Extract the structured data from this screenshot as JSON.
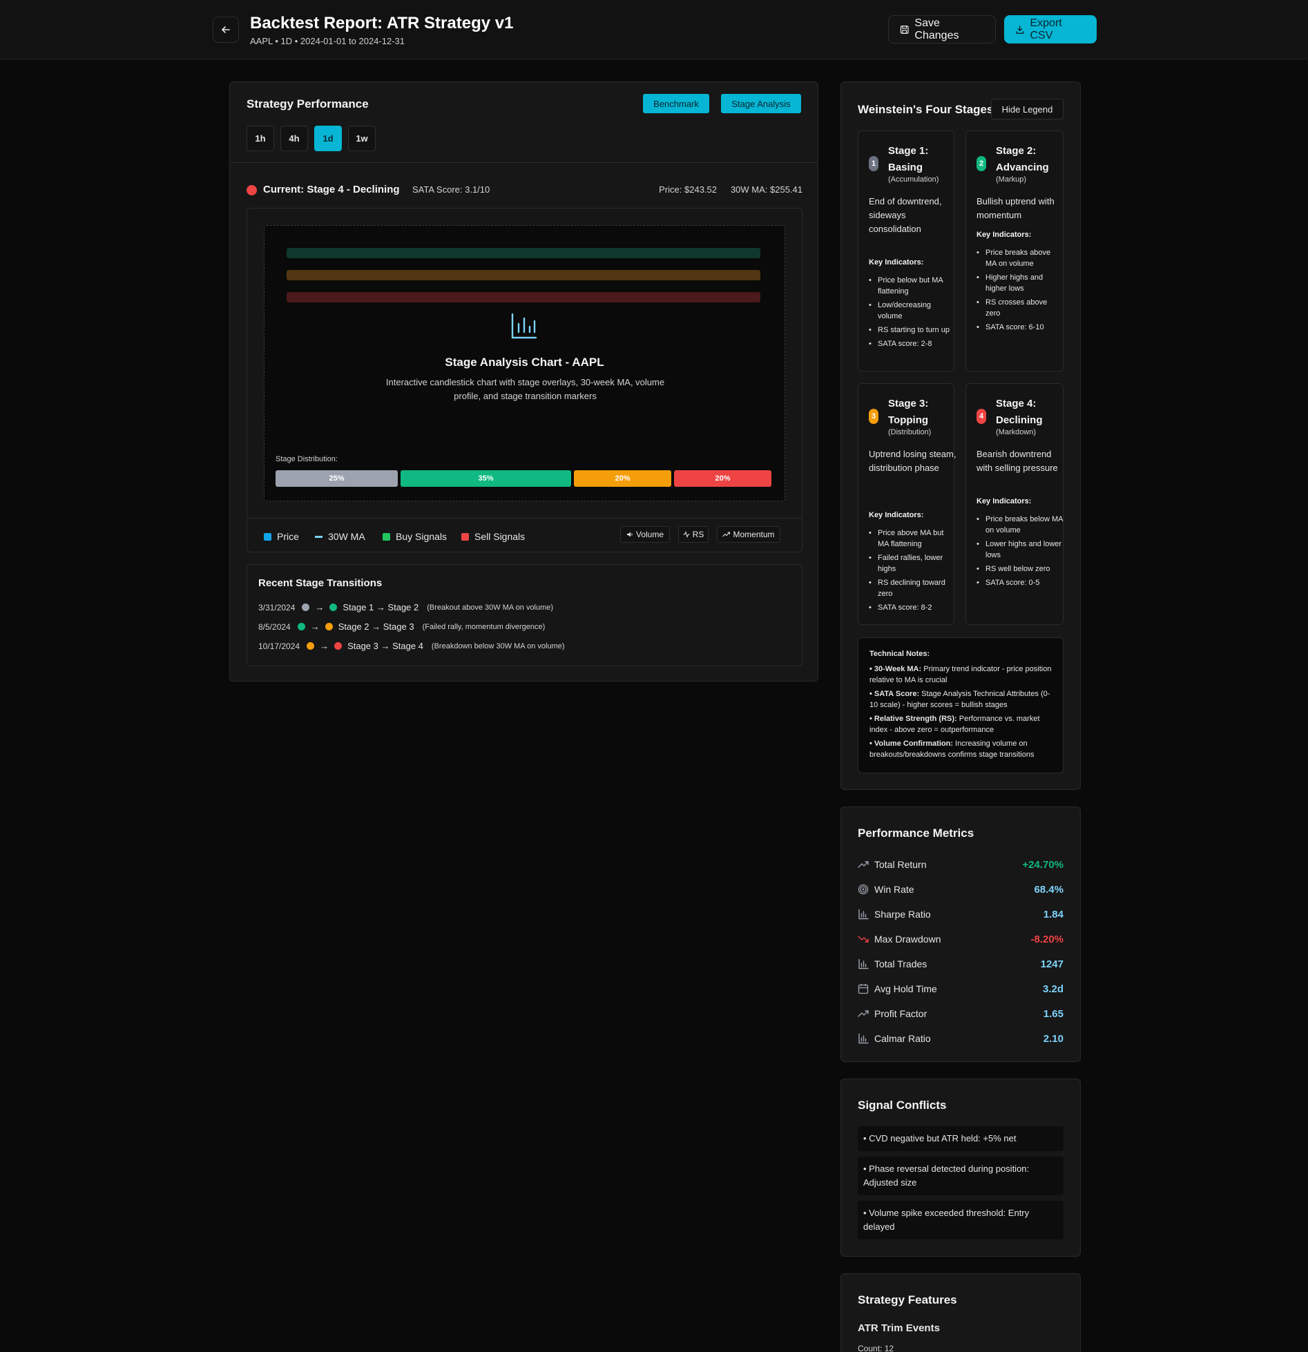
{
  "header": {
    "title": "Backtest Report: ATR Strategy v1",
    "subtitle": "AAPL • 1D • 2024-01-01 to 2024-12-31",
    "save_label": "Save Changes",
    "export_label": "Export CSV"
  },
  "performance": {
    "title": "Strategy Performance",
    "benchmark_label": "Benchmark",
    "stage_analysis_label": "Stage Analysis",
    "timeframes": [
      "1h",
      "4h",
      "1d",
      "1w"
    ],
    "active_timeframe": "1d",
    "current_stage": "Current: Stage 4 - Declining",
    "sata_score": "SATA Score: 3.1/10",
    "price": "Price: $243.52",
    "ma": "30W MA: $255.41",
    "chart_title": "Stage Analysis Chart - AAPL",
    "chart_desc": "Interactive candlestick chart with stage overlays, 30-week MA, volume profile, and stage transition markers",
    "distribution_label": "Stage Distribution:",
    "distribution": [
      {
        "label": "25%",
        "value": 25,
        "color": "#9ca3af"
      },
      {
        "label": "35%",
        "value": 35,
        "color": "#10b981"
      },
      {
        "label": "20%",
        "value": 20,
        "color": "#f59e0b"
      },
      {
        "label": "20%",
        "value": 20,
        "color": "#ef4444"
      }
    ],
    "legend": {
      "price": "Price",
      "ma": "30W MA",
      "buy": "Buy Signals",
      "sell": "Sell Signals"
    },
    "toggles": {
      "volume": "Volume",
      "rs": "RS",
      "momentum": "Momentum"
    },
    "transitions_title": "Recent Stage Transitions",
    "transitions": [
      {
        "date": "3/31/2024",
        "change": "Stage 1 → Stage 2",
        "note": "(Breakout above 30W MA on volume)"
      },
      {
        "date": "8/5/2024",
        "change": "Stage 2 → Stage 3",
        "note": "(Failed rally, momentum divergence)"
      },
      {
        "date": "10/17/2024",
        "change": "Stage 3 → Stage 4",
        "note": "(Breakdown below 30W MA on volume)"
      }
    ]
  },
  "stages": {
    "title": "Weinstein's Four Stages",
    "hide_legend": "Hide Legend",
    "key_indicators_label": "Key Indicators:",
    "items": [
      {
        "num": "1",
        "title": "Stage 1: Basing",
        "sub": "(Accumulation)",
        "desc": "End of downtrend, sideways consolidation",
        "indicators": [
          "Price below but MA flattening",
          "Low/decreasing volume",
          "RS starting to turn up",
          "SATA score: 2-8"
        ]
      },
      {
        "num": "2",
        "title": "Stage 2: Advancing",
        "sub": "(Markup)",
        "desc": "Bullish uptrend with momentum",
        "indicators": [
          "Price breaks above MA on volume",
          "Higher highs and higher lows",
          "RS crosses above zero",
          "SATA score: 6-10"
        ]
      },
      {
        "num": "3",
        "title": "Stage 3: Topping",
        "sub": "(Distribution)",
        "desc": "Uptrend losing steam, distribution phase",
        "indicators": [
          "Price above MA but MA flattening",
          "Failed rallies, lower highs",
          "RS declining toward zero",
          "SATA score: 8-2"
        ]
      },
      {
        "num": "4",
        "title": "Stage 4: Declining",
        "sub": "(Markdown)",
        "desc": "Bearish downtrend with selling pressure",
        "indicators": [
          "Price breaks below MA on volume",
          "Lower highs and lower lows",
          "RS well below zero",
          "SATA score: 0-5"
        ]
      }
    ],
    "notes_title": "Technical Notes:",
    "notes": [
      {
        "term": "• 30-Week MA:",
        "text": " Primary trend indicator - price position relative to MA is crucial"
      },
      {
        "term": "• SATA Score:",
        "text": " Stage Analysis Technical Attributes (0-10 scale) - higher scores = bullish stages"
      },
      {
        "term": "• Relative Strength (RS):",
        "text": " Performance vs. market index - above zero = outperformance"
      },
      {
        "term": "• Volume Confirmation:",
        "text": " Increasing volume on breakouts/breakdowns confirms stage transitions"
      }
    ]
  },
  "metrics": {
    "title": "Performance Metrics",
    "items": [
      {
        "label": "Total Return",
        "value": "+24.70%",
        "color": "#10b981",
        "icon": "trending-up-icon"
      },
      {
        "label": "Win Rate",
        "value": "68.4%",
        "color": "#7dd3fc",
        "icon": "target-icon"
      },
      {
        "label": "Sharpe Ratio",
        "value": "1.84",
        "color": "#7dd3fc",
        "icon": "bar-chart-icon"
      },
      {
        "label": "Max Drawdown",
        "value": "-8.20%",
        "color": "#ef4444",
        "icon": "trending-down-icon"
      },
      {
        "label": "Total Trades",
        "value": "1247",
        "color": "#7dd3fc",
        "icon": "bar-chart-icon"
      },
      {
        "label": "Avg Hold Time",
        "value": "3.2d",
        "color": "#7dd3fc",
        "icon": "calendar-icon"
      },
      {
        "label": "Profit Factor",
        "value": "1.65",
        "color": "#7dd3fc",
        "icon": "trending-up-icon"
      },
      {
        "label": "Calmar Ratio",
        "value": "2.10",
        "color": "#7dd3fc",
        "icon": "bar-chart-icon"
      }
    ]
  },
  "conflicts": {
    "title": "Signal Conflicts",
    "items": [
      "• CVD negative but ATR held: +5% net",
      "• Phase reversal detected during position: Adjusted size",
      "• Volume spike exceeded threshold: Entry delayed"
    ]
  },
  "features": {
    "title": "Strategy Features",
    "subtitle": "ATR Trim Events",
    "count": "Count: 12"
  },
  "colors": {
    "accent": "#06b6d4",
    "stage1": "#9ca3af",
    "stage2": "#10b981",
    "stage3": "#f59e0b",
    "stage4": "#ef4444"
  }
}
